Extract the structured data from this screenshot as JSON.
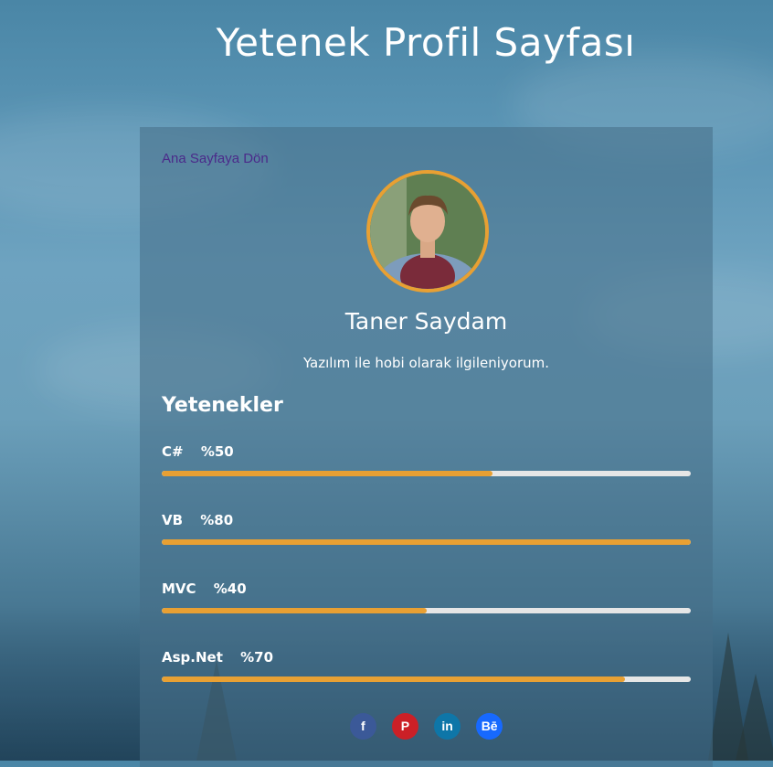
{
  "page": {
    "title": "Yetenek Profil Sayfası"
  },
  "card": {
    "back_link": "Ana Sayfaya Dön",
    "name": "Taner Saydam",
    "bio": "Yazılım ile hobi olarak ilgileniyorum.",
    "skills_heading": "Yetenekler",
    "skills": [
      {
        "name": "C#",
        "percent_label": "%50",
        "fill": 0.625
      },
      {
        "name": "VB",
        "percent_label": "%80",
        "fill": 1.0
      },
      {
        "name": "MVC",
        "percent_label": "%40",
        "fill": 0.5
      },
      {
        "name": "Asp.Net",
        "percent_label": "%70",
        "fill": 0.875
      }
    ],
    "social": [
      {
        "icon": "facebook-icon",
        "glyph": "f",
        "color": "#3b5998"
      },
      {
        "icon": "pinterest-icon",
        "glyph": "P",
        "color": "#cb2027"
      },
      {
        "icon": "linkedin-icon",
        "glyph": "in",
        "color": "#0e76a8"
      },
      {
        "icon": "behance-icon",
        "glyph": "Bē",
        "color": "#1769ff"
      }
    ]
  },
  "colors": {
    "accent": "#e8a033",
    "track": "#e6e6e6",
    "link": "#4b2a8a"
  }
}
